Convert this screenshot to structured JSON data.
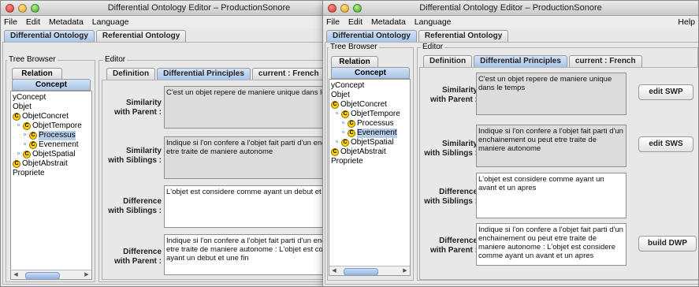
{
  "window1": {
    "title": "Differential Ontology Editor – ProductionSonore",
    "menu": [
      "File",
      "Edit",
      "Metadata",
      "Language"
    ],
    "tabs": [
      "Differential Ontology",
      "Referential Ontology"
    ],
    "tree_browser_label": "Tree Browser",
    "tree_tabs": [
      "Relation",
      "Concept"
    ],
    "tree": [
      "yConcept",
      "Objet",
      "ObjetConcret",
      "ObjetTempore",
      "Processus",
      "Evenement",
      "ObjetSpatial",
      "ObjetAbstrait",
      "Propriete"
    ],
    "editor_label": "Editor",
    "editor_tabs": [
      "Definition",
      "Differential Principles",
      "current : French"
    ],
    "fields": [
      {
        "label1": "Similarity",
        "label2": "with Parent :",
        "text": "C'est un objet repere de maniere unique dans le temps"
      },
      {
        "label1": "Similarity",
        "label2": "with Siblings :",
        "text": "Indique si l'on confere a l'objet fait parti d'un enchainement ou peut etre traite de maniere autonome"
      },
      {
        "label1": "Difference",
        "label2": "with Siblings :",
        "text": "L'objet est considere comme ayant un debut et une fin"
      },
      {
        "label1": "Difference",
        "label2": "with Parent :",
        "text": "Indique si l'on confere a l'objet fait parti d'un enchainement ou peut etre traite de maniere autonome : L'objet est considere comme ayant un debut et une fin"
      }
    ]
  },
  "window2": {
    "title": "Differential Ontology Editor – ProductionSonore",
    "menu": [
      "File",
      "Edit",
      "Metadata",
      "Language",
      "Help"
    ],
    "tabs": [
      "Differential Ontology",
      "Referential Ontology"
    ],
    "tree_browser_label": "Tree Browser",
    "tree_tabs": [
      "Relation",
      "Concept"
    ],
    "tree": [
      "yConcept",
      "Objet",
      "ObjetConcret",
      "ObjetTempore",
      "Processus",
      "Evenement",
      "ObjetSpatial",
      "ObjetAbstrait",
      "Propriete"
    ],
    "editor_label": "Editor",
    "editor_tabs": [
      "Definition",
      "Differential Principles",
      "current : French"
    ],
    "fields": [
      {
        "label1": "Similarity",
        "label2": "with Parent :",
        "text": "C'est un objet repere de maniere unique dans le temps"
      },
      {
        "label1": "Similarity",
        "label2": "with Siblings :",
        "text": "Indique si l'on confere a l'objet fait parti d'un enchainement ou peut etre traite de maniere autonome"
      },
      {
        "label1": "Difference",
        "label2": "with Siblings :",
        "text": "L'objet est considere comme ayant un avant et un apres"
      },
      {
        "label1": "Difference",
        "label2": "with Parent :",
        "text": "Indique si l'on confere a l'objet fait parti d'un enchainement ou peut etre traite de maniere autonome : L'objet est considere comme ayant un avant et un apres"
      }
    ],
    "buttons": [
      "edit SWP",
      "edit SWS",
      "build DWP"
    ]
  }
}
